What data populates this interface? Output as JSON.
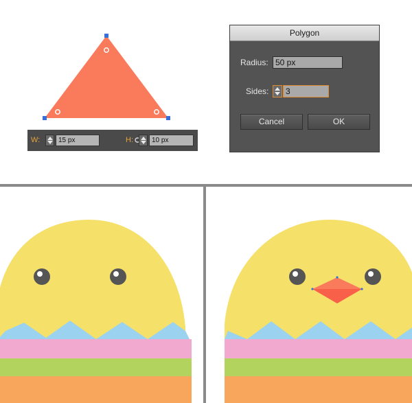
{
  "transform_bar": {
    "width_label": "W:",
    "width_value": "15 px",
    "height_label": "H:",
    "height_value": "10 px"
  },
  "polygon_dialog": {
    "title": "Polygon",
    "radius_label": "Radius:",
    "radius_value": "50 px",
    "sides_label": "Sides:",
    "sides_value": "3",
    "cancel_label": "Cancel",
    "ok_label": "OK"
  },
  "colors": {
    "triangle_fill": "#fa7a5c",
    "anchor_blue": "#3a6fd8",
    "label_orange": "#e8a23a",
    "chick_yellow": "#f5e06a",
    "eye_dark": "#555555",
    "beak_red": "#f9604a",
    "shell_blue": "#9bd2ef",
    "shell_pink": "#f1a9cf",
    "shell_green": "#b2d35e",
    "shell_orange": "#f8a65c"
  },
  "icons": [
    "anchor-point-icon",
    "link-proportions-icon",
    "spinner-arrows-icon"
  ]
}
